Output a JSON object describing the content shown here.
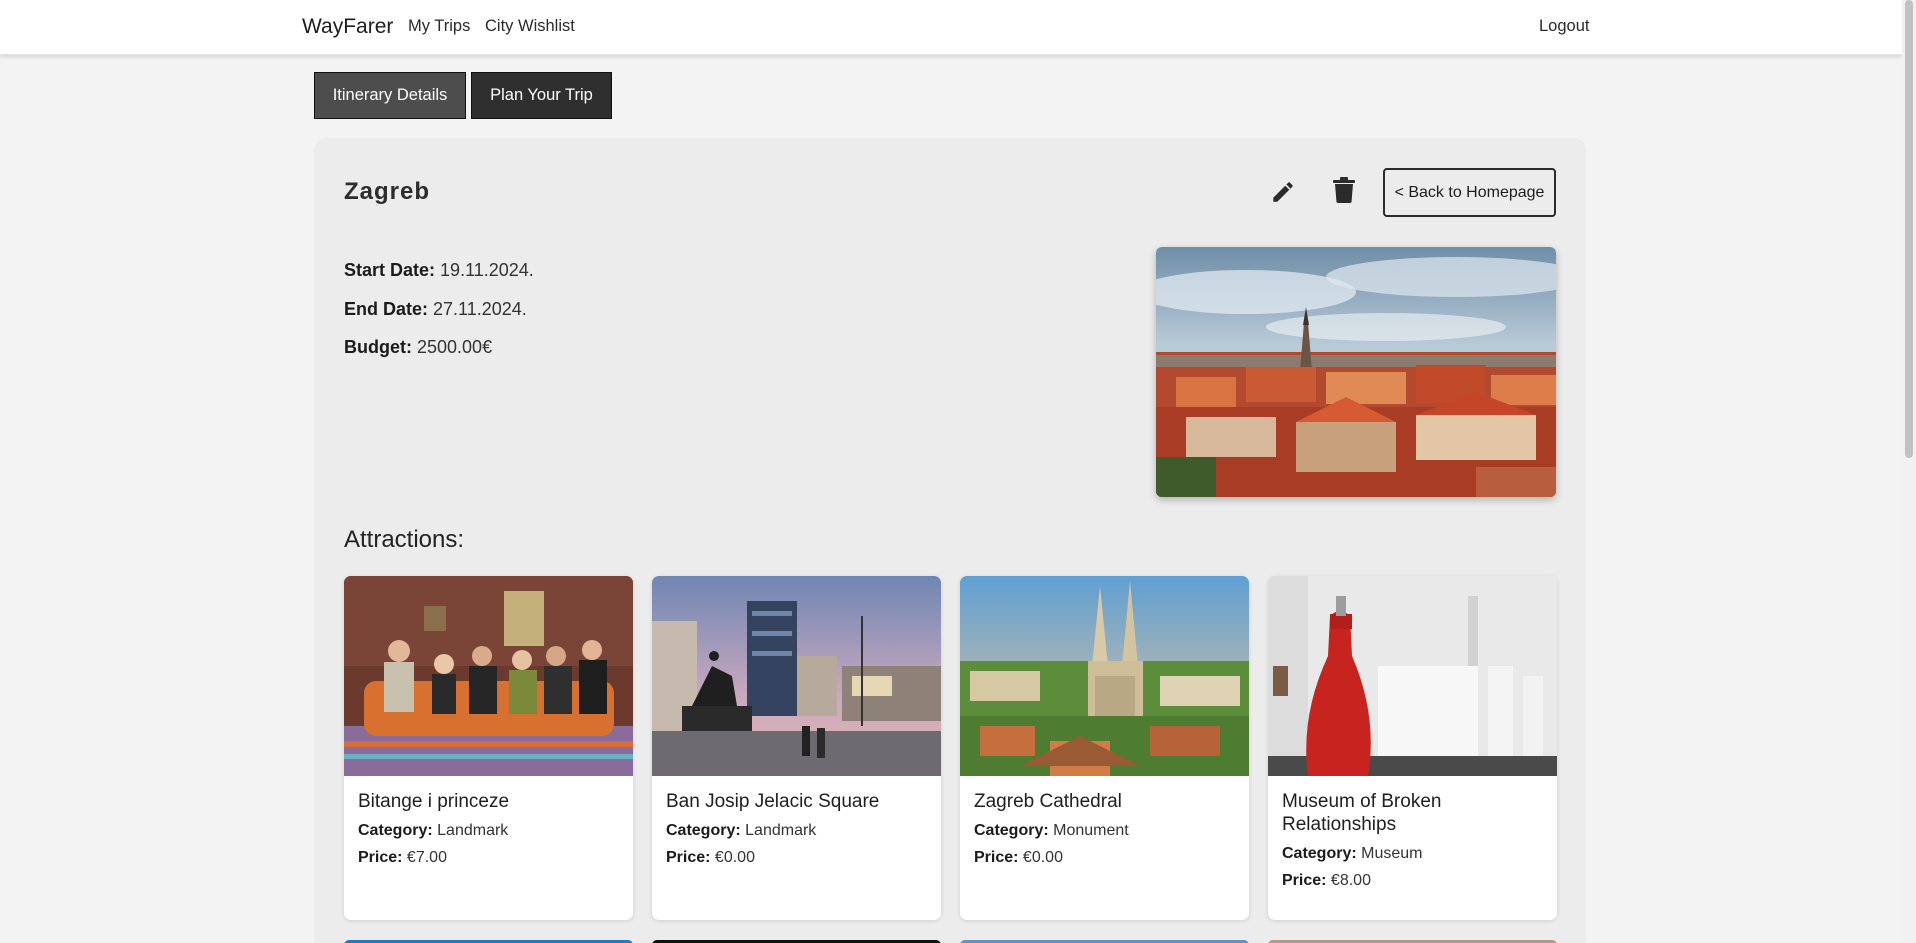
{
  "navbar": {
    "brand": "WayFarer",
    "links": [
      "My Trips",
      "City Wishlist"
    ],
    "logout": "Logout"
  },
  "tabs": [
    "Itinerary Details",
    "Plan Your Trip"
  ],
  "itinerary": {
    "city": "Zagreb",
    "back_label": "< Back to Homepage",
    "start_label": "Start Date:",
    "start_value": "19.11.2024.",
    "end_label": "End Date:",
    "end_value": "27.11.2024.",
    "budget_label": "Budget:",
    "budget_value": "2500.00€"
  },
  "attractions": {
    "heading": "Attractions:",
    "category_label": "Category:",
    "price_label": "Price:",
    "items": [
      {
        "name": "Bitange i princeze",
        "category": "Landmark",
        "price": "€7.00"
      },
      {
        "name": "Ban Josip Jelacic Square",
        "category": "Landmark",
        "price": "€0.00"
      },
      {
        "name": "Zagreb Cathedral",
        "category": "Monument",
        "price": "€0.00"
      },
      {
        "name": "Museum of Broken Relationships",
        "category": "Museum",
        "price": "€8.00"
      }
    ]
  },
  "icons": {
    "edit": "pencil-icon",
    "delete": "trash-icon"
  },
  "colors": {
    "tab_active": "#4d4d4d",
    "tab_dark": "#2f2f2f",
    "card_bg": "#ececec",
    "page_bg": "#f3f3f3"
  }
}
